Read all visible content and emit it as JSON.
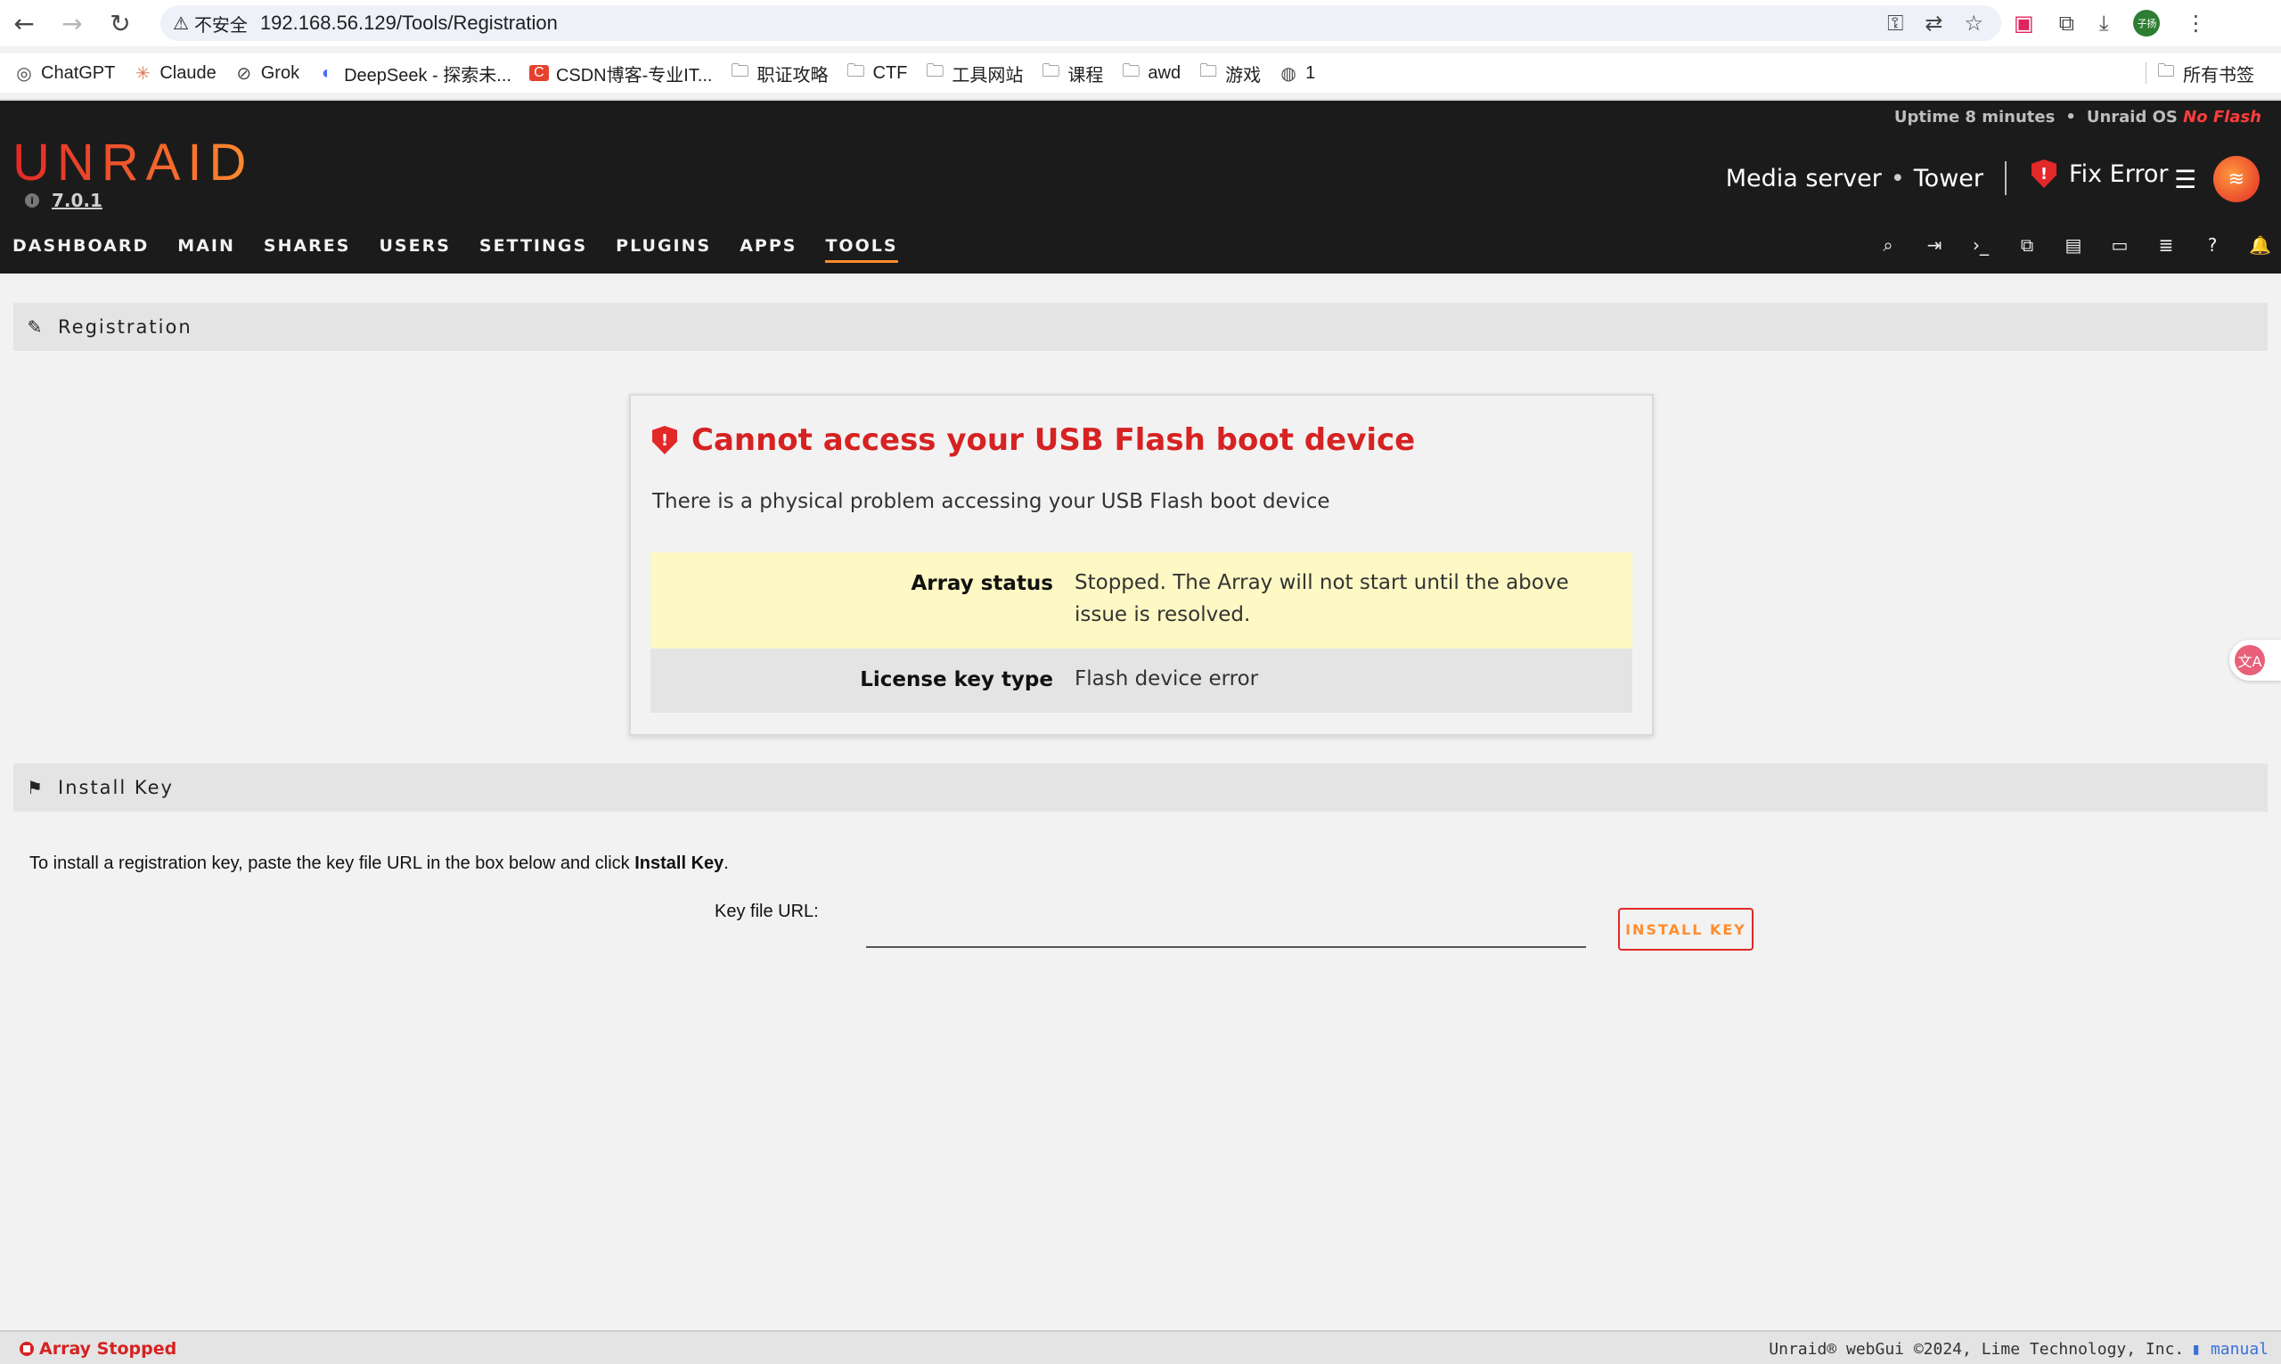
{
  "browser": {
    "security_label": "不安全",
    "url": "192.168.56.129/Tools/Registration",
    "bookmarks": [
      {
        "icon": "openai-icon",
        "glyph": "◎",
        "label": "ChatGPT"
      },
      {
        "icon": "claude-icon",
        "glyph": "✳",
        "label": "Claude"
      },
      {
        "icon": "grok-icon",
        "glyph": "⊘",
        "label": "Grok"
      },
      {
        "icon": "deepseek-icon",
        "glyph": "◐",
        "label": "DeepSeek - 探索未..."
      },
      {
        "icon": "csdn-icon",
        "glyph": "C",
        "label": "CSDN博客-专业IT..."
      },
      {
        "icon": "folder-icon",
        "glyph": "🗀",
        "label": "职证攻略"
      },
      {
        "icon": "folder-icon",
        "glyph": "🗀",
        "label": "CTF"
      },
      {
        "icon": "folder-icon",
        "glyph": "🗀",
        "label": "工具网站"
      },
      {
        "icon": "folder-icon",
        "glyph": "🗀",
        "label": "课程"
      },
      {
        "icon": "folder-icon",
        "glyph": "🗀",
        "label": "awd"
      },
      {
        "icon": "folder-icon",
        "glyph": "🗀",
        "label": "游戏"
      },
      {
        "icon": "globe-icon",
        "glyph": "◍",
        "label": "1"
      }
    ],
    "all_bookmarks_label": "所有书签",
    "profile_initials": "子扬"
  },
  "header": {
    "uptime": "Uptime 8 minutes",
    "os_label": "Unraid OS",
    "os_status": "No Flash",
    "logo": "UNRAID",
    "version": "7.0.1",
    "server_description": "Media server",
    "server_name": "Tower",
    "fix_error_label": "Fix Error"
  },
  "nav": {
    "items": [
      "DASHBOARD",
      "MAIN",
      "SHARES",
      "USERS",
      "SETTINGS",
      "PLUGINS",
      "APPS",
      "TOOLS"
    ],
    "active": "TOOLS"
  },
  "registration_section": {
    "title": "Registration"
  },
  "error_card": {
    "title": "Cannot access your USB Flash boot device",
    "description": "There is a physical problem accessing your USB Flash boot device",
    "rows": [
      {
        "label": "Array status",
        "value": "Stopped. The Array will not start until the above issue is resolved."
      },
      {
        "label": "License key type",
        "value": "Flash device error"
      }
    ]
  },
  "install_section": {
    "title": "Install Key",
    "desc_prefix": "To install a registration key, paste the key file URL in the box below and click ",
    "desc_bold": "Install Key",
    "desc_suffix": ".",
    "keyfile_label": "Key file URL:",
    "keyfile_value": "",
    "button_label": "INSTALL KEY"
  },
  "footer": {
    "array_status": "Array Stopped",
    "copyright": "Unraid® webGui ©2024, Lime Technology, Inc.",
    "manual": "manual"
  },
  "colors": {
    "accent_orange": "#ff8c2f",
    "accent_red": "#e22828",
    "header_bg": "#1c1b1b",
    "warning_yellow": "#fdf8c4"
  }
}
